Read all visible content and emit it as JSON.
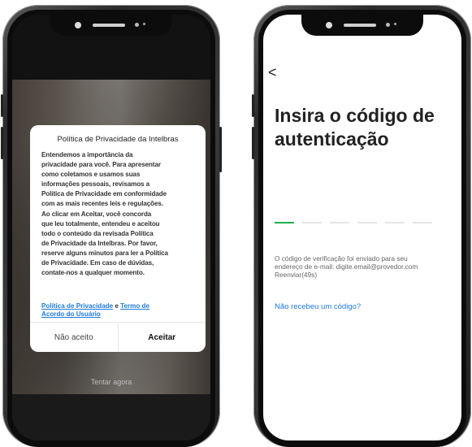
{
  "left_phone": {
    "dialog": {
      "title": "Política de Privacidade da Intelbras",
      "body_lines": [
        "Entendemos a importância da",
        "privacidade para você. Para apresentar",
        "como coletamos e usamos suas",
        "informações pessoais, revisamos a",
        "Política de Privacidade em conformidade",
        "com as mais recentes leis e regulações.",
        "Ao clicar em Aceitar, você concorda",
        "que leu totalmente, entendeu e aceitou",
        "todo o conteúdo da revisada Política",
        "de Privacidade da Intelbras. Por favor,",
        "reserve alguns minutos para ler a Política",
        "de Privacidade. Em caso de dúvidas,",
        "contate-nos a qualquer momento."
      ],
      "privacy_link": "Política de Privacidade",
      "connector": " e ",
      "terms_link_line1": "Termo de",
      "terms_link_line2": "Acordo do Usuário",
      "decline_label": "Não aceito",
      "accept_label": "Aceitar"
    },
    "try_now_label": "Tentar agora"
  },
  "right_phone": {
    "back_glyph": "<",
    "title": "Insira o código de autenticação",
    "code_slots": 6,
    "filled_slots": 1,
    "info_line1": "O código de verificação foi enviado para seu",
    "info_line2": "endereço de e-mail: digite.email@provedor.com",
    "info_line3": "Reenviar(49s)",
    "resend_label": "Não recebeu um código?"
  },
  "colors": {
    "accent_green": "#1cb34a",
    "link_blue": "#1e7be0"
  },
  "icons": [
    "back-arrow-icon"
  ]
}
